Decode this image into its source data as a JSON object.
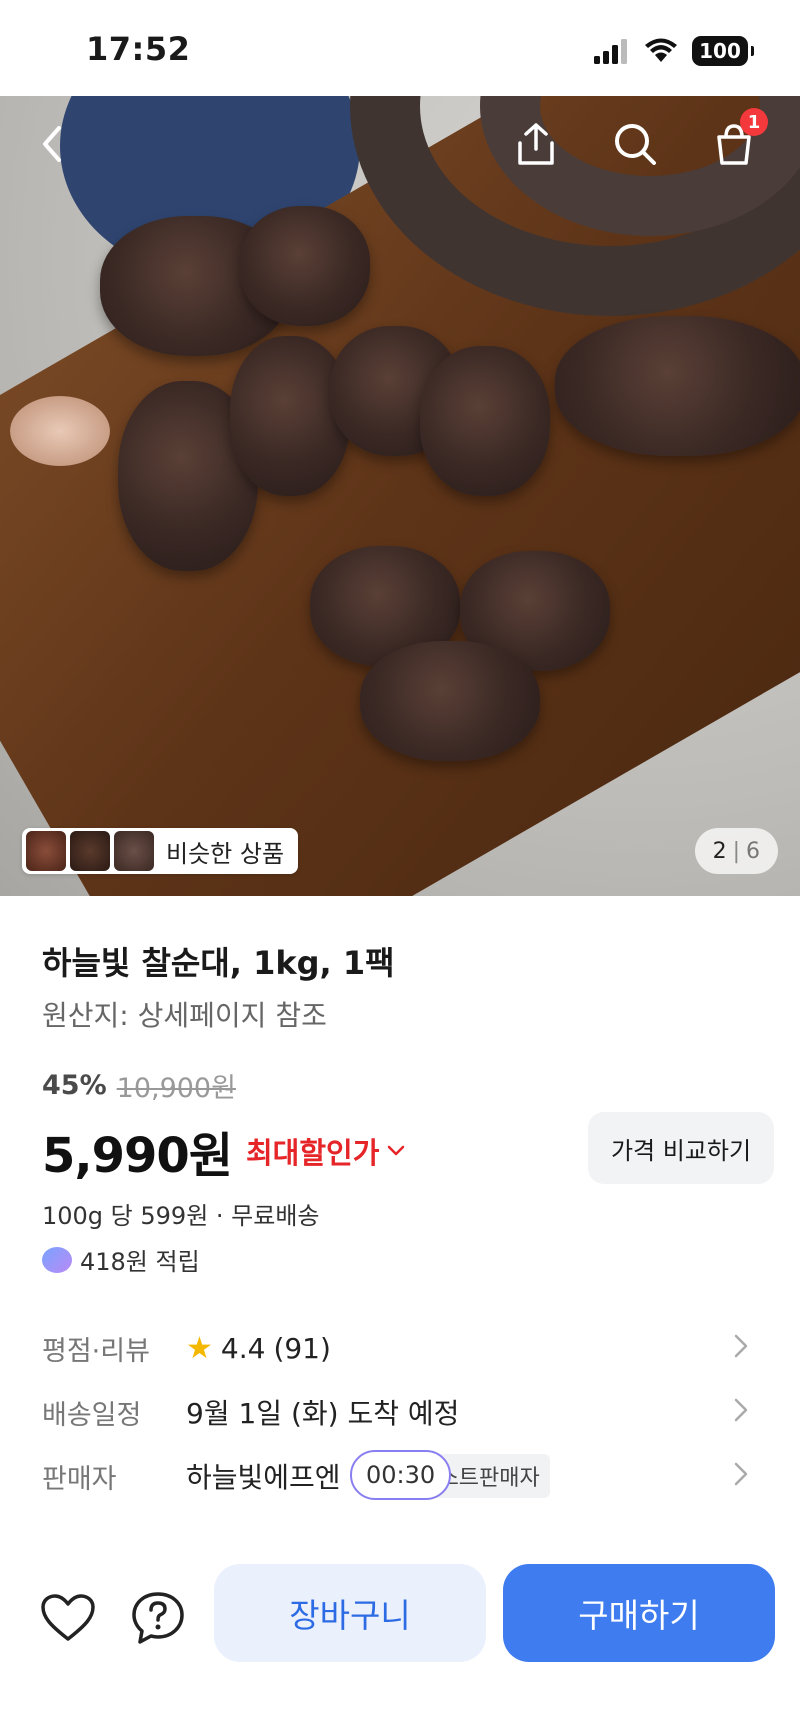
{
  "status_bar": {
    "time": "17:52",
    "battery": "100"
  },
  "hero": {
    "cart_badge": "1",
    "similar_label": "비슷한 상품",
    "pager_current": "2",
    "pager_sep": "|",
    "pager_total": "6"
  },
  "product": {
    "title": "하늘빛 찰순대, 1kg, 1팩",
    "origin": "원산지: 상세페이지 참조",
    "discount_rate": "45%",
    "original_price": "10,900원",
    "price": "5,990원",
    "max_discount_label": "최대할인가",
    "compare_label": "가격 비교하기",
    "unit_price": "100g 당 599원 · 무료배송",
    "points": "418원 적립"
  },
  "details": {
    "rating_label": "평점·리뷰",
    "rating": "4.4",
    "review_count": "(91)",
    "delivery_label": "배송일정",
    "delivery_value": "9월 1일 (화) 도착 예정",
    "seller_label": "판매자",
    "seller_value": "하늘빛에프엔",
    "seller_tag": "스트판매자",
    "timer": "00:30"
  },
  "bottom_bar": {
    "cart_label": "장바구니",
    "buy_label": "구매하기"
  },
  "colors": {
    "accent": "#3e7cf0",
    "discount_red": "#e52528",
    "badge_red": "#f4393c",
    "star": "#f5b800"
  }
}
